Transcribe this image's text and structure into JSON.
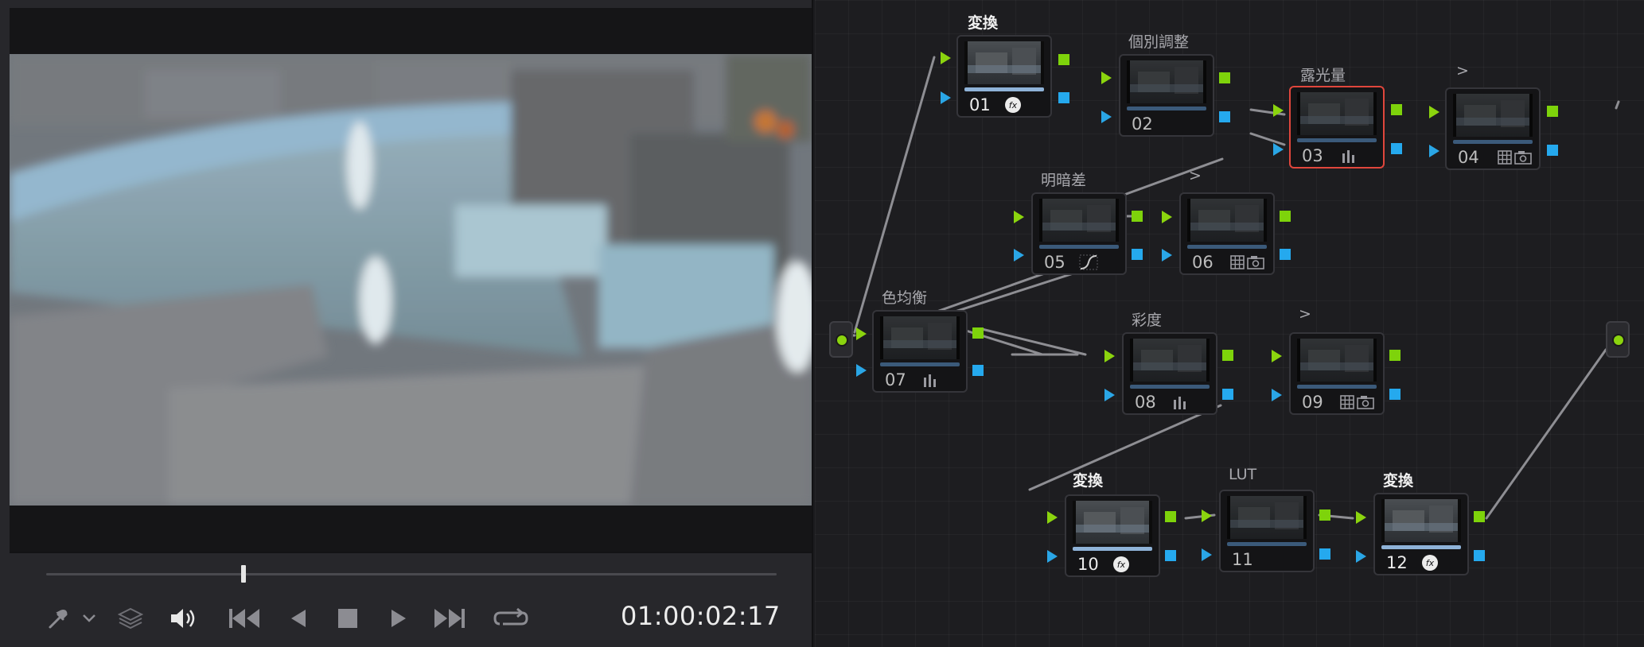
{
  "viewer": {
    "timecode": "01:00:02:17",
    "playhead_fraction": 0.27
  },
  "transport": {
    "icons": [
      "eyedropper-icon",
      "chevron-down-icon",
      "layers-icon",
      "speaker-icon",
      "skip-to-start-icon",
      "play-reverse-icon",
      "stop-icon",
      "play-icon",
      "skip-to-end-icon",
      "loop-icon"
    ]
  },
  "node_graph": {
    "nodes": [
      {
        "id": "01",
        "label": "変換",
        "icon": "fx-icon"
      },
      {
        "id": "02",
        "label": "個別調整",
        "icon": ""
      },
      {
        "id": "03",
        "label": "露光量",
        "icon": "bars-icon",
        "selected": true
      },
      {
        "id": "04",
        "label": ">",
        "icon": "grid-camera-icon"
      },
      {
        "id": "05",
        "label": "明暗差",
        "icon": "curve-icon"
      },
      {
        "id": "06",
        "label": ">",
        "icon": "grid-camera-icon"
      },
      {
        "id": "07",
        "label": "色均衡",
        "icon": "bars-icon"
      },
      {
        "id": "08",
        "label": "彩度",
        "icon": "bars-icon"
      },
      {
        "id": "09",
        "label": ">",
        "icon": "grid-camera-icon"
      },
      {
        "id": "10",
        "label": "変換",
        "icon": "fx-icon"
      },
      {
        "id": "11",
        "label": "LUT",
        "icon": ""
      },
      {
        "id": "12",
        "label": "変換",
        "icon": "fx-icon"
      }
    ]
  },
  "colors": {
    "green_port": "#8bd40e",
    "blue_port": "#25a9ee",
    "selected_border": "#e0463c",
    "wire": "#8e8e93"
  }
}
